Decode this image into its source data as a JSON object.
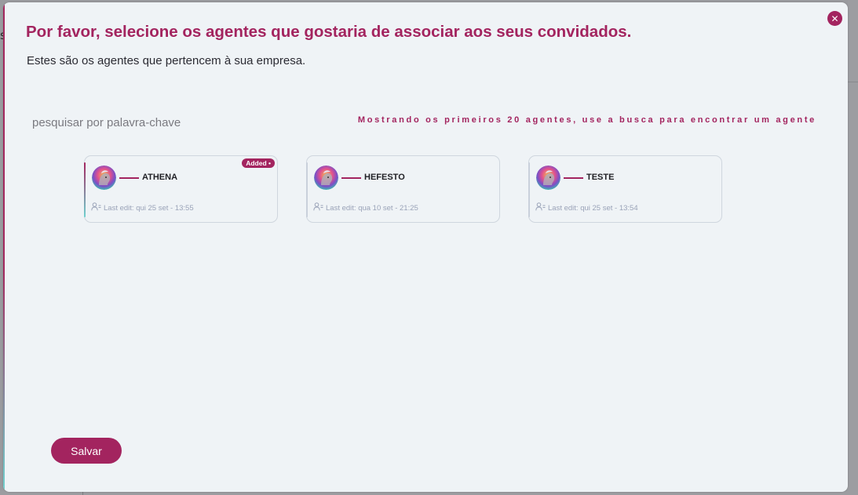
{
  "background": {
    "partial_text": "s"
  },
  "modal": {
    "title": "Por favor, selecione os agentes que gostaria de associar aos seus convidados.",
    "subtitle": "Estes são os agentes que pertencem à sua empresa.",
    "close_icon": "close-icon",
    "search": {
      "placeholder": "pesquisar por palavra-chave",
      "value": ""
    },
    "showing_note": "Mostrando os primeiros 20 agentes, use a busca para encontrar um agente",
    "agents": [
      {
        "name": "ATHENA",
        "last_edit": "Last edit: qui 25 set - 13:55",
        "badge": "Added •",
        "added": true
      },
      {
        "name": "HEFESTO",
        "last_edit": "Last edit: qua 10 set - 21:25",
        "badge": "",
        "added": false
      },
      {
        "name": "TESTE",
        "last_edit": "Last edit: qui 25 set - 13:54",
        "badge": "",
        "added": false
      }
    ],
    "save_label": "Salvar"
  },
  "colors": {
    "accent": "#a3245f",
    "modal_bg": "#eff3f6",
    "card_border": "#cfd6de",
    "meta_text": "#9aa3b8",
    "teal_accent": "#6fd2cf"
  }
}
